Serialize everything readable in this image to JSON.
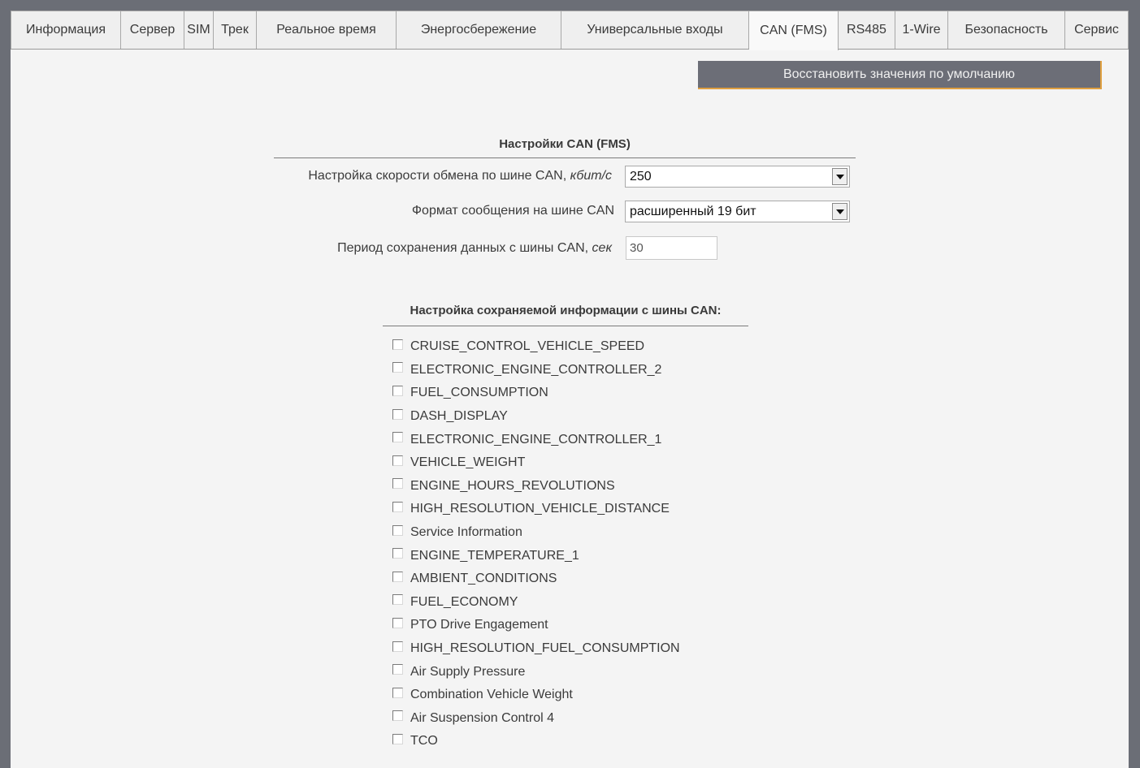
{
  "tabs": [
    {
      "label": "Информация",
      "active": false
    },
    {
      "label": "Сервер",
      "active": false
    },
    {
      "label": "SIM",
      "active": false
    },
    {
      "label": "Трек",
      "active": false
    },
    {
      "label": "Реальное время",
      "active": false
    },
    {
      "label": "Энергосбережение",
      "active": false
    },
    {
      "label": "Универсальные входы",
      "active": false
    },
    {
      "label": "CAN (FMS)",
      "active": true
    },
    {
      "label": "RS485",
      "active": false
    },
    {
      "label": "1-Wire",
      "active": false
    },
    {
      "label": "Безопасность",
      "active": false
    },
    {
      "label": "Сервис",
      "active": false
    }
  ],
  "restore_button": "Восстановить значения по умолчанию",
  "can_settings": {
    "title": "Настройки CAN (FMS)",
    "speed": {
      "label": "Настройка скорости обмена по шине CAN,",
      "unit": "кбит/с",
      "value": "250"
    },
    "format": {
      "label": "Формат сообщения на шине CAN",
      "value": "расширенный 19 бит"
    },
    "period": {
      "label": "Период сохранения данных с шины CAN,",
      "unit": "сек",
      "value": "30"
    }
  },
  "saved_info": {
    "title": "Настройка сохраняемой информации с шины CAN:",
    "items": [
      {
        "label": "CRUISE_CONTROL_VEHICLE_SPEED",
        "checked": false
      },
      {
        "label": "ELECTRONIC_ENGINE_CONTROLLER_2",
        "checked": false
      },
      {
        "label": "FUEL_CONSUMPTION",
        "checked": false
      },
      {
        "label": "DASH_DISPLAY",
        "checked": false
      },
      {
        "label": "ELECTRONIC_ENGINE_CONTROLLER_1",
        "checked": false
      },
      {
        "label": "VEHICLE_WEIGHT",
        "checked": false
      },
      {
        "label": "ENGINE_HOURS_REVOLUTIONS",
        "checked": false
      },
      {
        "label": "HIGH_RESOLUTION_VEHICLE_DISTANCE",
        "checked": false
      },
      {
        "label": "Service Information",
        "checked": false
      },
      {
        "label": "ENGINE_TEMPERATURE_1",
        "checked": false
      },
      {
        "label": "AMBIENT_CONDITIONS",
        "checked": false
      },
      {
        "label": "FUEL_ECONOMY",
        "checked": false
      },
      {
        "label": "PTO Drive Engagement",
        "checked": false
      },
      {
        "label": "HIGH_RESOLUTION_FUEL_CONSUMPTION",
        "checked": false
      },
      {
        "label": "Air Supply Pressure",
        "checked": false
      },
      {
        "label": "Combination Vehicle Weight",
        "checked": false
      },
      {
        "label": "Air Suspension Control 4",
        "checked": false
      },
      {
        "label": "TCO",
        "checked": false
      }
    ]
  }
}
